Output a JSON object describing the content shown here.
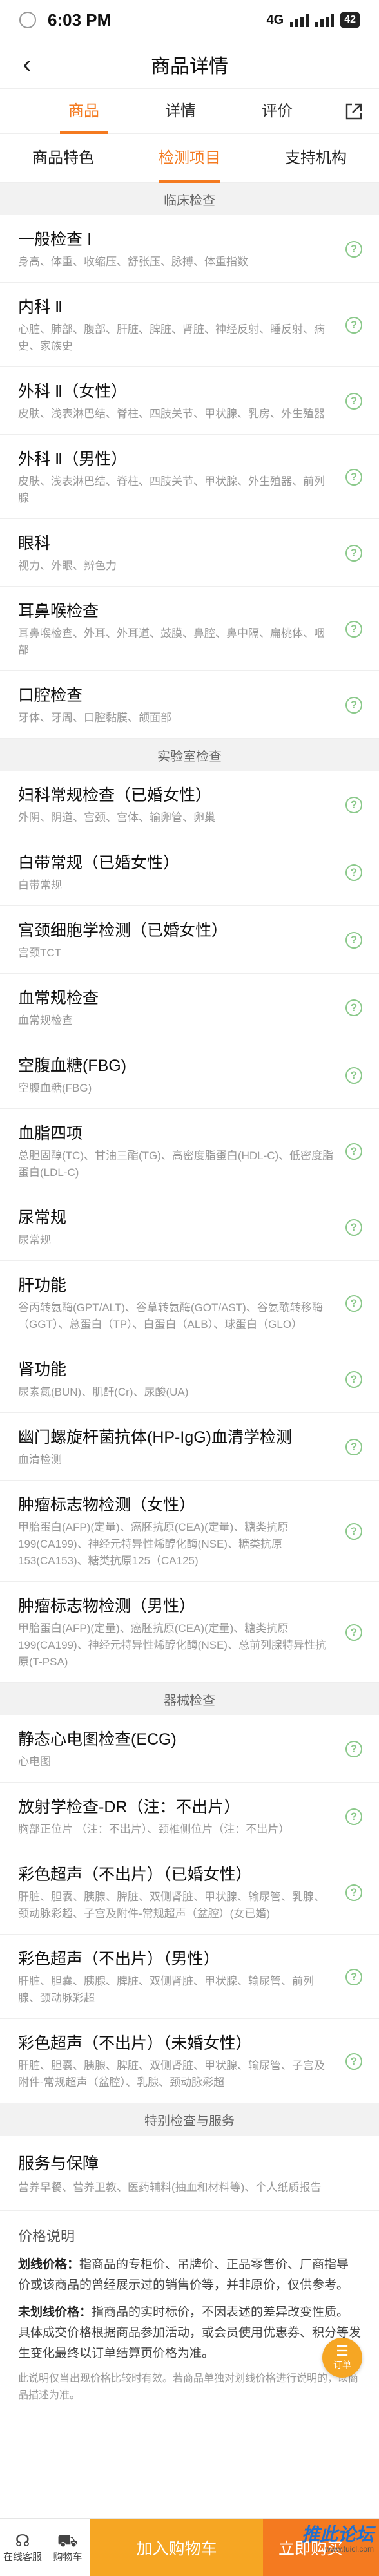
{
  "status_bar": {
    "time": "6:03 PM",
    "network": "4G",
    "battery": "42"
  },
  "navbar": {
    "title": "商品详情"
  },
  "top_tabs": [
    "商品",
    "详情",
    "评价"
  ],
  "sub_tabs": [
    "商品特色",
    "检测项目",
    "支持机构"
  ],
  "sections": [
    {
      "header": "临床检查",
      "items": [
        {
          "title": "一般检查 Ⅰ",
          "desc": "身高、体重、收缩压、舒张压、脉搏、体重指数"
        },
        {
          "title": "内科 Ⅱ",
          "desc": "心脏、肺部、腹部、肝脏、脾脏、肾脏、神经反射、睡反射、病史、家族史"
        },
        {
          "title": "外科 Ⅱ（女性）",
          "desc": "皮肤、浅表淋巴结、脊柱、四肢关节、甲状腺、乳房、外生殖器"
        },
        {
          "title": "外科 Ⅱ（男性）",
          "desc": "皮肤、浅表淋巴结、脊柱、四肢关节、甲状腺、外生殖器、前列腺"
        },
        {
          "title": "眼科",
          "desc": "视力、外眼、辨色力"
        },
        {
          "title": "耳鼻喉检查",
          "desc": "耳鼻喉检查、外耳、外耳道、鼓膜、鼻腔、鼻中隔、扁桃体、咽部"
        },
        {
          "title": "口腔检查",
          "desc": "牙体、牙周、口腔黏膜、颌面部"
        }
      ]
    },
    {
      "header": "实验室检查",
      "items": [
        {
          "title": "妇科常规检查（已婚女性）",
          "desc": "外阴、阴道、宫颈、宫体、输卵管、卵巢"
        },
        {
          "title": "白带常规（已婚女性）",
          "desc": "白带常规"
        },
        {
          "title": "宫颈细胞学检测（已婚女性）",
          "desc": "宫颈TCT"
        },
        {
          "title": "血常规检查",
          "desc": "血常规检查"
        },
        {
          "title": "空腹血糖(FBG)",
          "desc": "空腹血糖(FBG)"
        },
        {
          "title": "血脂四项",
          "desc": "总胆固醇(TC)、甘油三酯(TG)、高密度脂蛋白(HDL-C)、低密度脂蛋白(LDL-C)"
        },
        {
          "title": "尿常规",
          "desc": "尿常规"
        },
        {
          "title": "肝功能",
          "desc": "谷丙转氨酶(GPT/ALT)、谷草转氨酶(GOT/AST)、谷氨酰转移酶（GGT）、总蛋白（TP）、白蛋白（ALB）、球蛋白（GLO）"
        },
        {
          "title": "肾功能",
          "desc": "尿素氮(BUN)、肌酐(Cr)、尿酸(UA)"
        },
        {
          "title": "幽门螺旋杆菌抗体(HP-IgG)血清学检测",
          "desc": "血清检测"
        },
        {
          "title": "肿瘤标志物检测（女性）",
          "desc": "甲胎蛋白(AFP)(定量)、癌胚抗原(CEA)(定量)、糖类抗原199(CA199)、神经元特异性烯醇化酶(NSE)、糖类抗原153(CA153)、糖类抗原125（CA125)"
        },
        {
          "title": "肿瘤标志物检测（男性）",
          "desc": "甲胎蛋白(AFP)(定量)、癌胚抗原(CEA)(定量)、糖类抗原199(CA199)、神经元特异性烯醇化酶(NSE)、总前列腺特异性抗原(T-PSA)"
        }
      ]
    },
    {
      "header": "器械检查",
      "items": [
        {
          "title": "静态心电图检查(ECG)",
          "desc": "心电图"
        },
        {
          "title": "放射学检查-DR（注：不出片）",
          "desc": "胸部正位片 （注：不出片）、颈椎侧位片（注：不出片）"
        },
        {
          "title": "彩色超声（不出片）（已婚女性）",
          "desc": "肝脏、胆囊、胰腺、脾脏、双侧肾脏、甲状腺、输尿管、乳腺、颈动脉彩超、子宫及附件-常规超声（盆腔）(女已婚)"
        },
        {
          "title": "彩色超声（不出片）（男性）",
          "desc": "肝脏、胆囊、胰腺、脾脏、双侧肾脏、甲状腺、输尿管、前列腺、颈动脉彩超"
        },
        {
          "title": "彩色超声（不出片）（未婚女性）",
          "desc": "肝脏、胆囊、胰腺、脾脏、双侧肾脏、甲状腺、输尿管、子宫及附件-常规超声（盆腔）、乳腺、颈动脉彩超"
        }
      ]
    }
  ],
  "service_section": {
    "header": "特别检查与服务",
    "title": "服务与保障",
    "desc": "营养早餐、营养卫教、医药辅料(抽血和材料等)、个人纸质报告"
  },
  "price_note": {
    "heading": "价格说明",
    "line1_label": "划线价格：",
    "line1_text": "指商品的专柜价、吊牌价、正品零售价、厂商指导价或该商品的曾经展示过的销售价等，并非原价，仅供参考。",
    "line2_label": "未划线价格：",
    "line2_text": "指商品的实时标价，不因表述的差异改变性质。具体成交价格根据商品参加活动，或会员使用优惠券、积分等发生变化最终以订单结算页价格为准。",
    "small": "此说明仅当出现价格比较时有效。若商品单独对划线价格进行说明的，以商品描述为准。"
  },
  "float_button": {
    "label": "订单"
  },
  "bottom_bar": {
    "service_label": "在线客服",
    "cart_label": "购物车",
    "add_cart": "加入购物车",
    "buy_now": "立即购买",
    "watermark": "推此论坛",
    "watermark_sub": "www.tuicl.com"
  },
  "colors": {
    "accent": "#f47a20",
    "button_yellow": "#f6a623",
    "help_green": "#8bc98b"
  }
}
